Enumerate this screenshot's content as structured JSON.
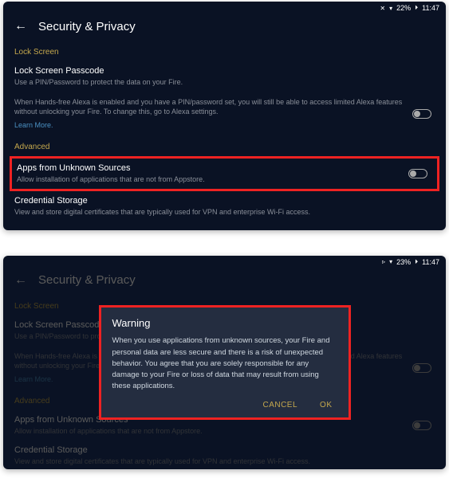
{
  "status1": {
    "wifi": "✕",
    "signal": "▾",
    "battery_pct": "22%",
    "batt_icon": "⏵",
    "time": "11:47"
  },
  "status2": {
    "wifi": "▹",
    "signal": "▾",
    "battery_pct": "23%",
    "batt_icon": "⏵",
    "time": "11:47"
  },
  "header": {
    "title": "Security & Privacy"
  },
  "sections": {
    "lock_screen_header": "Lock Screen",
    "advanced_header": "Advanced"
  },
  "items": {
    "passcode": {
      "title": "Lock Screen Passcode",
      "sub": "Use a PIN/Password to protect the data on your Fire."
    },
    "alexa_note": {
      "text": "When Hands-free Alexa is enabled and you have a PIN/password set, you will still be able to access limited Alexa features without unlocking your Fire. To change this, go to Alexa settings.",
      "link": "Learn More."
    },
    "unknown": {
      "title": "Apps from Unknown Sources",
      "sub": "Allow installation of applications that are not from Appstore."
    },
    "credential": {
      "title": "Credential Storage",
      "sub": "View and store digital certificates that are typically used for VPN and enterprise Wi-Fi access."
    }
  },
  "dialog": {
    "title": "Warning",
    "body": "When you use applications from unknown sources, your Fire and personal data are less secure and there is a risk of unexpected behavior. You agree that you are solely responsible for any damage to your Fire or loss of data that may result from using these applications.",
    "cancel": "CANCEL",
    "ok": "OK"
  }
}
